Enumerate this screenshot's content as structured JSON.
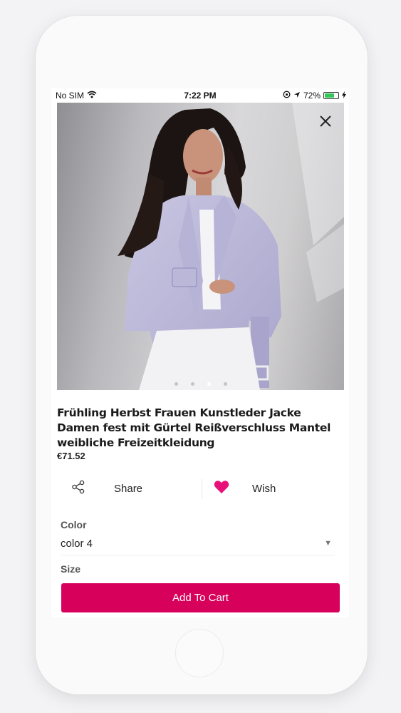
{
  "status_bar": {
    "carrier": "No SIM",
    "time": "7:22 PM",
    "battery_percent": "72%",
    "battery_level": 0.72,
    "battery_color": "#35c759"
  },
  "product": {
    "title": "Frühling Herbst Frauen Kunstleder Jacke Damen fest mit Gürtel Reißverschluss Mantel weibliche Freizeitkleidung",
    "price": "€71.52",
    "image_page_count": 4,
    "image_page_active": 3
  },
  "actions": {
    "share_label": "Share",
    "wish_label": "Wish"
  },
  "options": {
    "color_label": "Color",
    "color_value": "color 4",
    "size_label": "Size"
  },
  "cart": {
    "add_label": "Add To Cart",
    "accent_color": "#d7005a"
  },
  "icons": [
    "wifi-icon",
    "lock-rotation-icon",
    "location-arrow-icon",
    "battery-icon",
    "charging-icon",
    "close-icon",
    "share-icon",
    "heart-icon",
    "chevron-down-icon"
  ]
}
